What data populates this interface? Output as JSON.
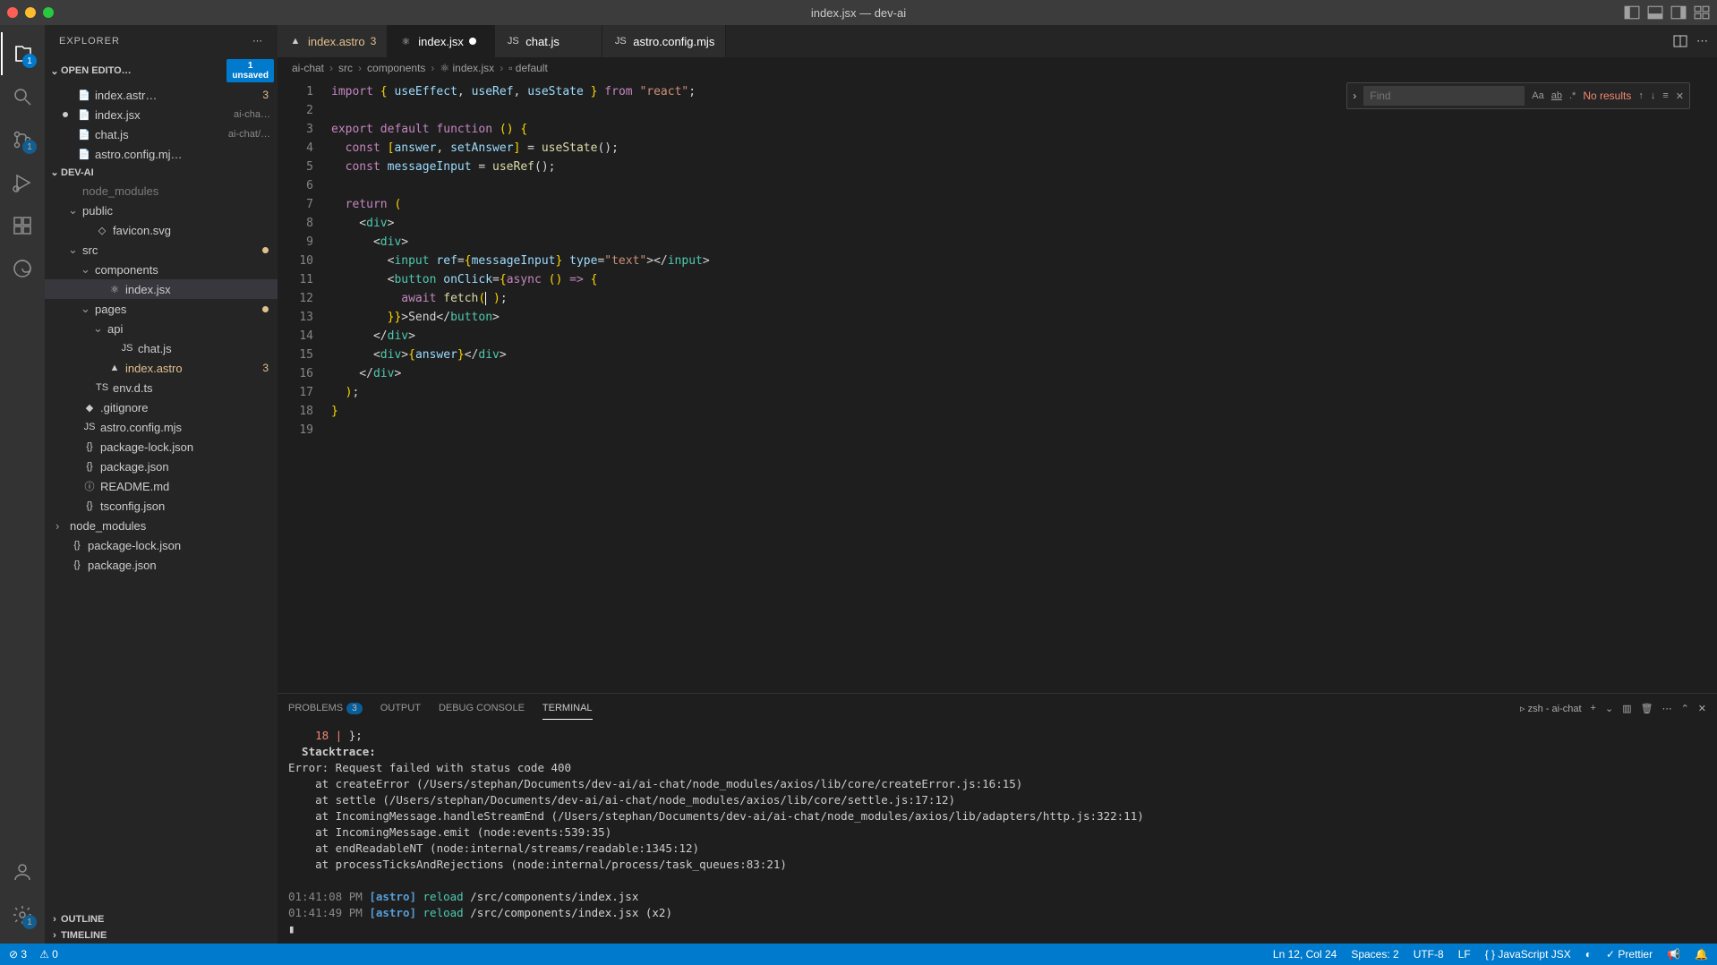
{
  "window": {
    "title": "index.jsx — dev-ai"
  },
  "activity": {
    "explorer_badge": "1",
    "scm_badge": "1"
  },
  "sidebar": {
    "title": "EXPLORER",
    "openEditors": {
      "label": "OPEN EDITO…",
      "unsaved_count": "1",
      "unsaved_label": "unsaved",
      "items": [
        {
          "name": "index.astr…",
          "badge": "3",
          "icon": "astro"
        },
        {
          "name": "index.jsx",
          "suffix": "ai-cha…",
          "dirty": true,
          "icon": "react"
        },
        {
          "name": "chat.js",
          "suffix": "ai-chat/…",
          "icon": "js"
        },
        {
          "name": "astro.config.mj…",
          "icon": "js"
        }
      ]
    },
    "project": {
      "label": "DEV-AI",
      "tree": [
        {
          "name": "node_modules",
          "depth": 1,
          "chev": "",
          "dim": true
        },
        {
          "name": "public",
          "depth": 1,
          "chev": "⌄"
        },
        {
          "name": "favicon.svg",
          "depth": 2,
          "icon": "svg"
        },
        {
          "name": "src",
          "depth": 1,
          "chev": "⌄",
          "mod": true
        },
        {
          "name": "components",
          "depth": 2,
          "chev": "⌄"
        },
        {
          "name": "index.jsx",
          "depth": 3,
          "icon": "react",
          "selected": true
        },
        {
          "name": "pages",
          "depth": 2,
          "chev": "⌄",
          "mod": true
        },
        {
          "name": "api",
          "depth": 3,
          "chev": "⌄"
        },
        {
          "name": "chat.js",
          "depth": 4,
          "icon": "js"
        },
        {
          "name": "index.astro",
          "depth": 3,
          "icon": "astro",
          "badge": "3",
          "warn": true
        },
        {
          "name": "env.d.ts",
          "depth": 2,
          "icon": "ts"
        },
        {
          "name": ".gitignore",
          "depth": 1,
          "icon": "git"
        },
        {
          "name": "astro.config.mjs",
          "depth": 1,
          "icon": "js"
        },
        {
          "name": "package-lock.json",
          "depth": 1,
          "icon": "json"
        },
        {
          "name": "package.json",
          "depth": 1,
          "icon": "json"
        },
        {
          "name": "README.md",
          "depth": 1,
          "icon": "md"
        },
        {
          "name": "tsconfig.json",
          "depth": 1,
          "icon": "json"
        },
        {
          "name": "node_modules",
          "depth": 0,
          "chev": "›"
        },
        {
          "name": "package-lock.json",
          "depth": 0,
          "icon": "json"
        },
        {
          "name": "package.json",
          "depth": 0,
          "icon": "json"
        }
      ]
    },
    "outline": "OUTLINE",
    "timeline": "TIMELINE"
  },
  "tabs": [
    {
      "label": "index.astro",
      "badge": "3",
      "icon": "astro",
      "warn": true
    },
    {
      "label": "index.jsx",
      "dirty": true,
      "icon": "react",
      "active": true
    },
    {
      "label": "chat.js",
      "icon": "js"
    },
    {
      "label": "astro.config.mjs",
      "icon": "js"
    }
  ],
  "breadcrumb": [
    "ai-chat",
    "src",
    "components",
    "index.jsx",
    "default"
  ],
  "find": {
    "placeholder": "Find",
    "result": "No results"
  },
  "code_lines": [
    1,
    2,
    3,
    4,
    5,
    6,
    7,
    8,
    9,
    10,
    11,
    12,
    13,
    14,
    15,
    16,
    17,
    18,
    19
  ],
  "panel": {
    "tabs": {
      "problems": "PROBLEMS",
      "problems_badge": "3",
      "output": "OUTPUT",
      "debug": "DEBUG CONSOLE",
      "terminal": "TERMINAL"
    },
    "terminal_label": "zsh - ai-chat"
  },
  "terminal_output": {
    "l1_a": "    18 | ",
    "l1_b": "};",
    "l2": "  Stacktrace:",
    "l3": "Error: Request failed with status code 400",
    "l4": "    at createError (/Users/stephan/Documents/dev-ai/ai-chat/node_modules/axios/lib/core/createError.js:16:15)",
    "l5": "    at settle (/Users/stephan/Documents/dev-ai/ai-chat/node_modules/axios/lib/core/settle.js:17:12)",
    "l6": "    at IncomingMessage.handleStreamEnd (/Users/stephan/Documents/dev-ai/ai-chat/node_modules/axios/lib/adapters/http.js:322:11)",
    "l7": "    at IncomingMessage.emit (node:events:539:35)",
    "l8": "    at endReadableNT (node:internal/streams/readable:1345:12)",
    "l9": "    at processTicksAndRejections (node:internal/process/task_queues:83:21)",
    "r1_ts": "01:41:08 PM ",
    "r1_tag": "[astro]",
    "r1_act": " reload ",
    "r1_path": "/src/components/index.jsx",
    "r2_ts": "01:41:49 PM ",
    "r2_tag": "[astro]",
    "r2_act": " reload ",
    "r2_path": "/src/components/index.jsx (x2)",
    "cursor": "▮"
  },
  "status": {
    "errors": "3",
    "warnings": "0",
    "cursor": "Ln 12, Col 24",
    "spaces": "Spaces: 2",
    "encoding": "UTF-8",
    "eol": "LF",
    "lang": "JavaScript JSX",
    "prettier": "Prettier"
  }
}
